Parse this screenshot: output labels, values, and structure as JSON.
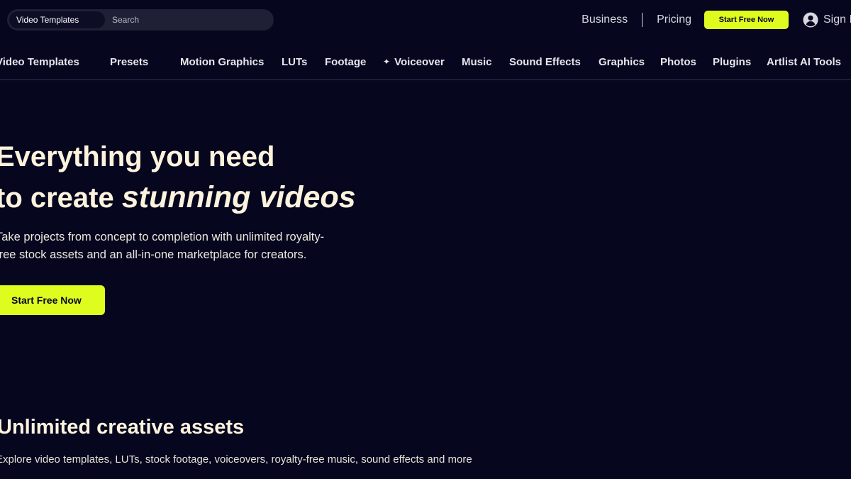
{
  "search": {
    "category": "Video Templates",
    "placeholder": "Search",
    "value": ""
  },
  "header": {
    "business_label": "Business",
    "pricing_label": "Pricing",
    "cta_label": "Start Free Now",
    "signin_label": "Sign In"
  },
  "nav": {
    "items": [
      {
        "label": "Video Templates"
      },
      {
        "label": "Presets"
      },
      {
        "label": "Motion Graphics"
      },
      {
        "label": "LUTs"
      },
      {
        "label": "Footage"
      },
      {
        "label": "Voiceover",
        "icon": "sparkle-icon"
      },
      {
        "label": "Music"
      },
      {
        "label": "Sound Effects"
      },
      {
        "label": "Graphics"
      },
      {
        "label": "Photos"
      },
      {
        "label": "Plugins"
      },
      {
        "label": "Artlist AI Tools"
      }
    ]
  },
  "hero": {
    "title_line1": "Everything you need",
    "title_line2_prefix": "to create ",
    "title_line2_emphasis": "stunning videos",
    "description_line1": "Take projects from concept to completion with unlimited royalty-",
    "description_line2": "free stock assets and an all-in-one marketplace for creators.",
    "cta_label": "Start Free Now"
  },
  "assets_section": {
    "title": "Unlimited creative assets",
    "description": "Explore video templates, LUTs, stock footage, voiceovers, royalty-free music, sound effects and more"
  },
  "colors": {
    "background": "#06061f",
    "accent": "#dffc1f",
    "heading_text": "#fdf3dd",
    "search_bar": "#1f2036"
  },
  "icons": {
    "sparkle": "sparkle-icon",
    "user": "user-icon"
  }
}
